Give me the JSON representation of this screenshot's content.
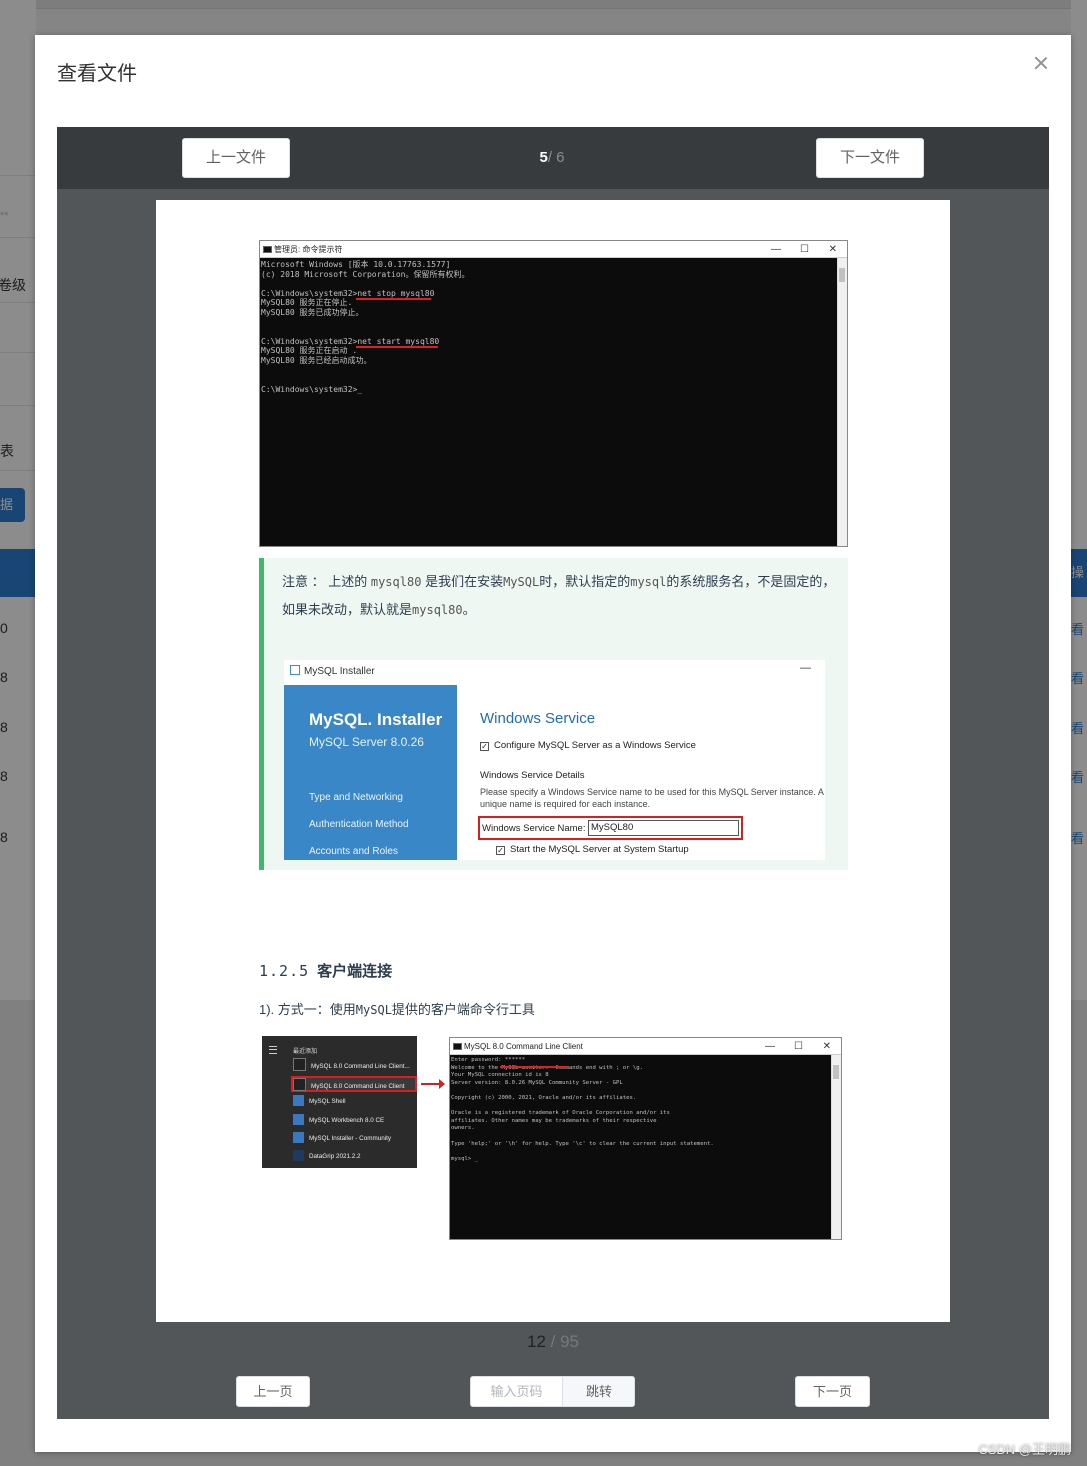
{
  "background": {
    "left_fragments": [
      "**",
      "卷级",
      "表",
      "据",
      "0",
      "8",
      "8",
      "8",
      "8"
    ],
    "right_header": "操",
    "right_links": [
      "看",
      "看",
      "看",
      "看",
      "看"
    ]
  },
  "dialog": {
    "title": "查看文件",
    "close_icon": "close-icon"
  },
  "file_nav": {
    "prev_label": "上一文件",
    "next_label": "下一文件",
    "current": "5",
    "total": "/ 6"
  },
  "document": {
    "cmd1": {
      "window_title": "管理员: 命令提示符",
      "controls": [
        "—",
        "☐",
        "✕"
      ],
      "lines": [
        "Microsoft Windows [版本 10.0.17763.1577]",
        "(c) 2018 Microsoft Corporation。保留所有权利。",
        "",
        "C:\\Windows\\system32>net stop mysql80",
        "MySQL80 服务正在停止.",
        "MySQL80 服务已成功停止。",
        "",
        "",
        "C:\\Windows\\system32>net start mysql80",
        "MySQL80 服务正在启动 .",
        "MySQL80 服务已经启动成功。",
        "",
        "",
        "C:\\Windows\\system32>_"
      ]
    },
    "note": {
      "prefix": "注意 ： 上述的",
      "code1": "mysql80",
      "middle1": "是我们在安装",
      "code2": "MySQL",
      "middle2": "时，默认指定的",
      "code3": "mysql",
      "middle3": "的系统服务名，不是固定的，如果未改动，默认就是",
      "code4": "mysql80",
      "suffix": "。"
    },
    "installer": {
      "window_title": "MySQL Installer",
      "minimize": "—",
      "logo": "MySQL. Installer",
      "version": "MySQL Server 8.0.26",
      "steps": [
        "Type and Networking",
        "Authentication Method",
        "Accounts and Roles"
      ],
      "heading": "Windows Service",
      "configure_label": "Configure MySQL Server as a Windows Service",
      "details_title": "Windows Service Details",
      "details_desc": "Please specify a Windows Service name to be used for this MySQL Server instance. A unique name is required for each instance.",
      "service_name_label": "Windows Service Name:",
      "service_name_value": "MySQL80",
      "startup_label": "Start the MySQL Server at System Startup"
    },
    "section_number": "1.2.5",
    "section_title": "客户端连接",
    "para_prefix": "1). 方式一：使用",
    "para_code": "MySQL",
    "para_suffix": "提供的客户端命令行工具",
    "start_menu": {
      "header": "最近添加",
      "items": [
        "MySQL 8.0 Command Line Client...",
        "MySQL 8.0 Command Line Client",
        "MySQL Shell",
        "MySQL Workbench 8.0 CE",
        "MySQL Installer - Community",
        "DataGrip 2021.2.2"
      ]
    },
    "cmd2": {
      "window_title": "MySQL 8.0 Command Line Client",
      "controls": [
        "—",
        "☐",
        "✕"
      ],
      "lines": [
        "Enter password: ******",
        "Welcome to the MySQL monitor.  Commands end with ; or \\g.",
        "Your MySQL connection id is 8",
        "Server version: 8.0.26 MySQL Community Server - GPL",
        "",
        "Copyright (c) 2000, 2021, Oracle and/or its affiliates.",
        "",
        "Oracle is a registered trademark of Oracle Corporation and/or its",
        "affiliates. Other names may be trademarks of their respective",
        "owners.",
        "",
        "Type 'help;' or '\\h' for help. Type '\\c' to clear the current input statement.",
        "",
        "mysql> _"
      ]
    }
  },
  "page_nav": {
    "current": "12",
    "total": "/ 95",
    "prev_label": "上一页",
    "next_label": "下一页",
    "input_placeholder": "输入页码",
    "jump_label": "跳转"
  },
  "watermark": "CSDN @王明鹏"
}
